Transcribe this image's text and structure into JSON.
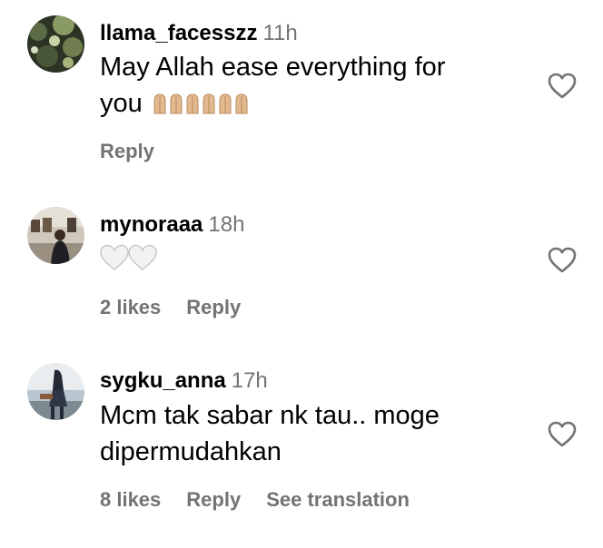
{
  "comments": [
    {
      "username": "llama_facesszz",
      "time": "11h",
      "text_line1": "May Allah ease everything for",
      "text_line2": "you",
      "emoji": "🙏🏼🙏🏼🙏🏼🙏🏼🙏🏼🙏🏼",
      "reply": "Reply"
    },
    {
      "username": "mynoraaa",
      "time": "18h",
      "emoji": "🤍🤍",
      "likes": "2 likes",
      "reply": "Reply"
    },
    {
      "username": "sygku_anna",
      "time": "17h",
      "text_line1": "Mcm tak sabar nk tau.. moge",
      "text_line2": "dipermudahkan",
      "likes": "8 likes",
      "reply": "Reply",
      "translate": "See translation"
    }
  ],
  "colors": {
    "secondary_text": "#737373",
    "primary_text": "#000000",
    "heart_outline": "#737373"
  },
  "icons": {
    "like": "heart-outline-icon",
    "hands": "folded-hands-emoji",
    "white_heart": "white-heart-emoji"
  }
}
